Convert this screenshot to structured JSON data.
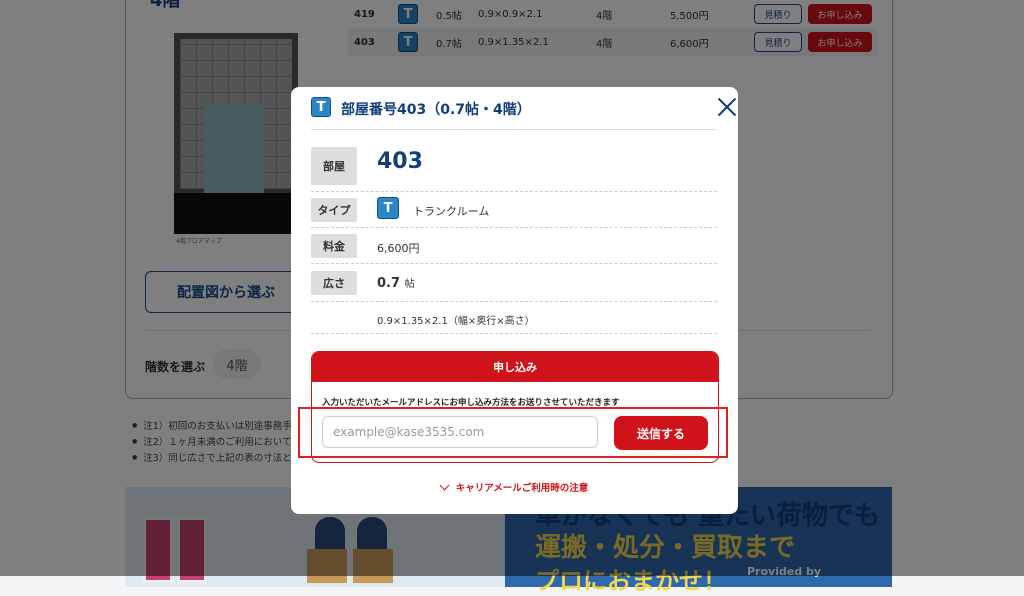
{
  "background": {
    "floor_title": "4階",
    "floorplan_caption": "4階フロアマップ",
    "layout_button_label": "配置図から選ぶ",
    "floor_select_label": "階数を選ぶ",
    "floor_chip": "4階",
    "rooms": [
      {
        "number": "419",
        "type_icon": "T",
        "size": "0.5帖",
        "dimensions": "0.9×0.9×2.1",
        "floor": "4階",
        "price": "5,500円",
        "quote": "見積り",
        "apply": "お申し込み"
      },
      {
        "number": "403",
        "type_icon": "T",
        "size": "0.7帖",
        "dimensions": "0.9×1.35×2.1",
        "floor": "4階",
        "price": "6,600円",
        "quote": "見積り",
        "apply": "お申し込み"
      }
    ],
    "notes": [
      "注1）初回のお支払いは別途事務手",
      "注2）１ヶ月未満のご利用において",
      "注3）同じ広さで上記の表の寸法と"
    ],
    "banner": {
      "line1": "車がなくても  重たい荷物でも",
      "line2": "運搬・処分・買取まで",
      "line3": "プロにおまかせ！",
      "provided": "Provided by"
    }
  },
  "modal": {
    "type_icon": "T",
    "title": "部屋番号403（0.7帖・4階）",
    "details": {
      "room_label": "部屋",
      "room_value": "403",
      "type_label": "タイプ",
      "type_value": "トランクルーム",
      "price_label": "料金",
      "price_value": "6,600円",
      "size_label": "広さ",
      "size_value": "0.7",
      "size_unit": "帖",
      "dimensions": "0.9×1.35×2.1（幅×奥行×高さ）"
    },
    "apply": {
      "header": "申し込み",
      "description": "入力いただいたメールアドレスにお申し込み方法をお送りさせていただきます",
      "email_value": "",
      "email_placeholder": "example@kase3535.com",
      "send_label": "送信する"
    },
    "carrier_note": "キャリアメールご利用時の注意"
  },
  "colors": {
    "brand_navy": "#123e7a",
    "accent_red": "#d0131a",
    "badge_blue": "#2b86c9"
  }
}
